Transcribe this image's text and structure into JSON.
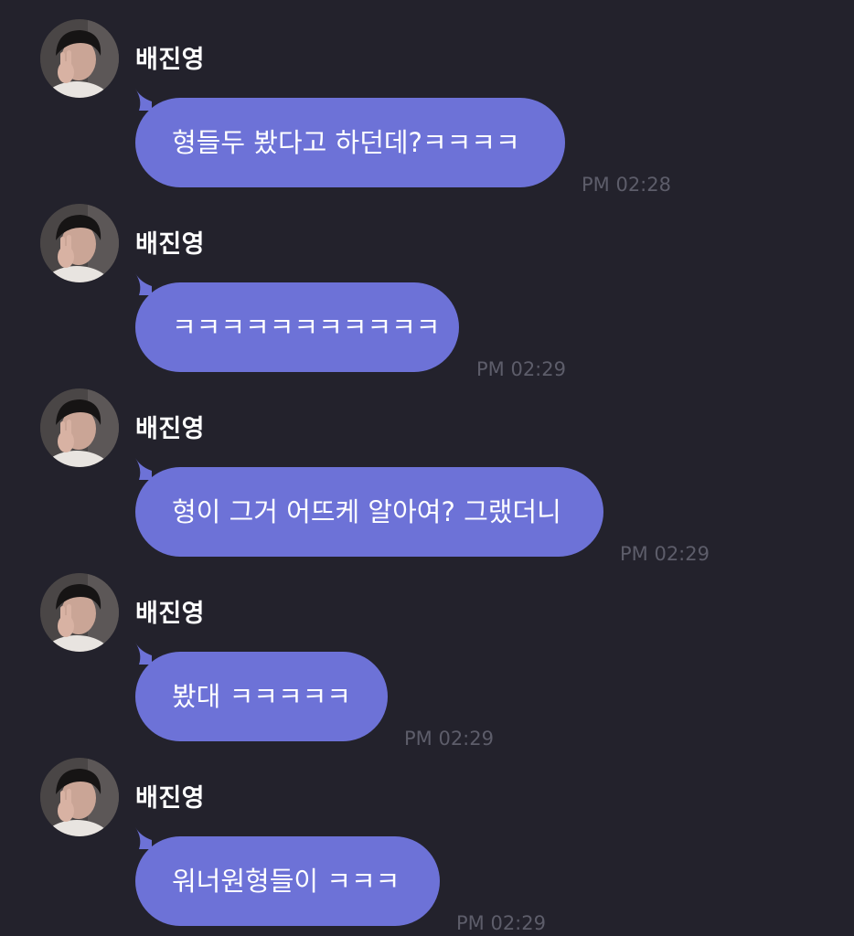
{
  "colors": {
    "background": "#23222c",
    "bubble": "#6d72d7",
    "timestamp": "#5d5d6a",
    "text": "#ffffff"
  },
  "messages": [
    {
      "sender": "배진영",
      "text": "형들두 봤다고 하던데?ㅋㅋㅋㅋ",
      "time": "PM 02:28",
      "avatar_icon": "profile-avatar"
    },
    {
      "sender": "배진영",
      "text": "ㅋㅋㅋㅋㅋㅋㅋㅋㅋㅋㅋ",
      "time": "PM 02:29",
      "avatar_icon": "profile-avatar"
    },
    {
      "sender": "배진영",
      "text": "형이 그거 어뜨케 알아여? 그랬더니",
      "time": "PM 02:29",
      "avatar_icon": "profile-avatar"
    },
    {
      "sender": "배진영",
      "text": "봤대 ㅋㅋㅋㅋㅋ",
      "time": "PM 02:29",
      "avatar_icon": "profile-avatar"
    },
    {
      "sender": "배진영",
      "text": "워너원형들이 ㅋㅋㅋ",
      "time": "PM 02:29",
      "avatar_icon": "profile-avatar"
    }
  ]
}
